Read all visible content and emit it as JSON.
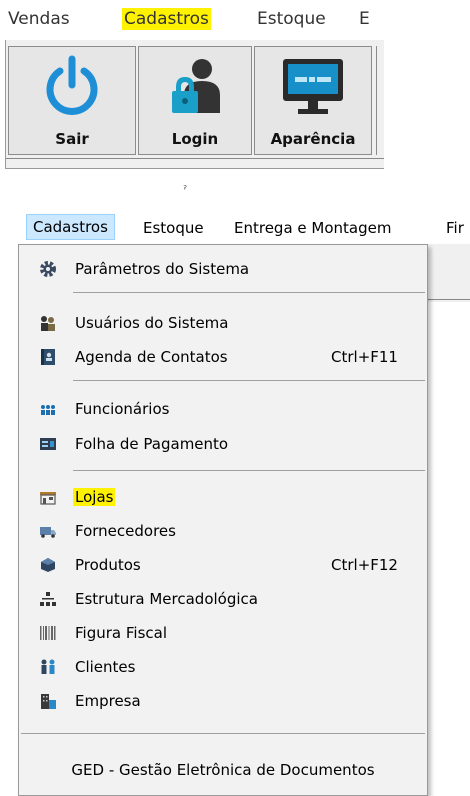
{
  "top_menu": {
    "items": [
      {
        "label": "Vendas"
      },
      {
        "label": "Cadastros",
        "highlighted": true
      },
      {
        "label": "Estoque"
      },
      {
        "label": "E"
      }
    ],
    "highlight_color": "#fff200"
  },
  "toolbar": {
    "buttons": [
      {
        "label": "Sair",
        "icon": "power-icon"
      },
      {
        "label": "Login",
        "icon": "user-lock-icon"
      },
      {
        "label": "Aparência",
        "icon": "monitor-icon"
      }
    ]
  },
  "menubar": {
    "items": [
      {
        "label": "Cadastros",
        "active": true
      },
      {
        "label": "Estoque"
      },
      {
        "label": "Entrega e Montagem"
      },
      {
        "label": "Fir"
      }
    ]
  },
  "cadastros_menu": {
    "items": [
      {
        "label": "Parâmetros do Sistema",
        "icon": "gear-icon",
        "shortcut": ""
      },
      {
        "label": "Usuários do Sistema",
        "icon": "users-icon",
        "shortcut": ""
      },
      {
        "label": "Agenda de Contatos",
        "icon": "contacts-book-icon",
        "shortcut": "Ctrl+F11"
      },
      {
        "label": "Funcionários",
        "icon": "employees-icon",
        "shortcut": ""
      },
      {
        "label": "Folha de Pagamento",
        "icon": "payroll-icon",
        "shortcut": ""
      },
      {
        "label": "Lojas",
        "icon": "store-icon",
        "shortcut": "",
        "highlighted": true
      },
      {
        "label": "Fornecedores",
        "icon": "truck-icon",
        "shortcut": ""
      },
      {
        "label": "Produtos",
        "icon": "products-icon",
        "shortcut": "Ctrl+F12"
      },
      {
        "label": "Estrutura Mercadológica",
        "icon": "hierarchy-icon",
        "shortcut": ""
      },
      {
        "label": "Figura Fiscal",
        "icon": "barcode-icon",
        "shortcut": ""
      },
      {
        "label": "Clientes",
        "icon": "clients-icon",
        "shortcut": ""
      },
      {
        "label": "Empresa",
        "icon": "building-icon",
        "shortcut": ""
      }
    ],
    "footer": "GED - Gestão Eletrônica de Documentos"
  }
}
